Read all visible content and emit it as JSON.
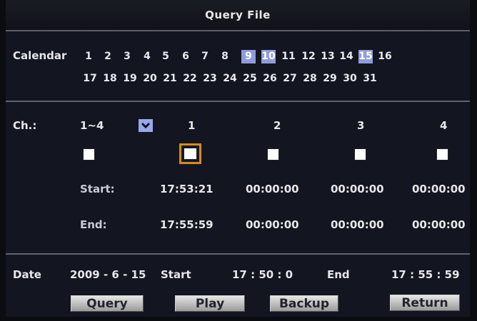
{
  "title": "Query File",
  "calendar": {
    "label": "Calendar",
    "row1": [
      "1",
      "2",
      "3",
      "4",
      "5",
      "6",
      "7",
      "8",
      "9",
      "10",
      "11",
      "12",
      "13",
      "14",
      "15",
      "16"
    ],
    "row2": [
      "17",
      "18",
      "19",
      "20",
      "21",
      "22",
      "23",
      "24",
      "25",
      "26",
      "27",
      "28",
      "29",
      "30",
      "31"
    ],
    "highlighted": [
      "9",
      "10",
      "15"
    ]
  },
  "channels": {
    "label": "Ch.:",
    "range": "1~4",
    "headers": [
      "1",
      "2",
      "3",
      "4"
    ],
    "dropdown_icon": "chevron-down-icon",
    "start_label": "Start:",
    "end_label": "End:",
    "starts": [
      "17:53:21",
      "00:00:00",
      "00:00:00",
      "00:00:00"
    ],
    "ends": [
      "17:55:59",
      "00:00:00",
      "00:00:00",
      "00:00:00"
    ],
    "selected_channel": "1"
  },
  "date": {
    "label": "Date",
    "value": "2009 - 6 - 15",
    "start_label": "Start",
    "start_value": "17 : 50 : 0",
    "end_label": "End",
    "end_value": "17 : 55 : 59"
  },
  "buttons": {
    "query": "Query",
    "play": "Play",
    "backup": "Backup",
    "return": "Return"
  },
  "colors": {
    "background": "#131620",
    "highlight": "#8f9cdc",
    "selected_border": "#d58b1f"
  }
}
